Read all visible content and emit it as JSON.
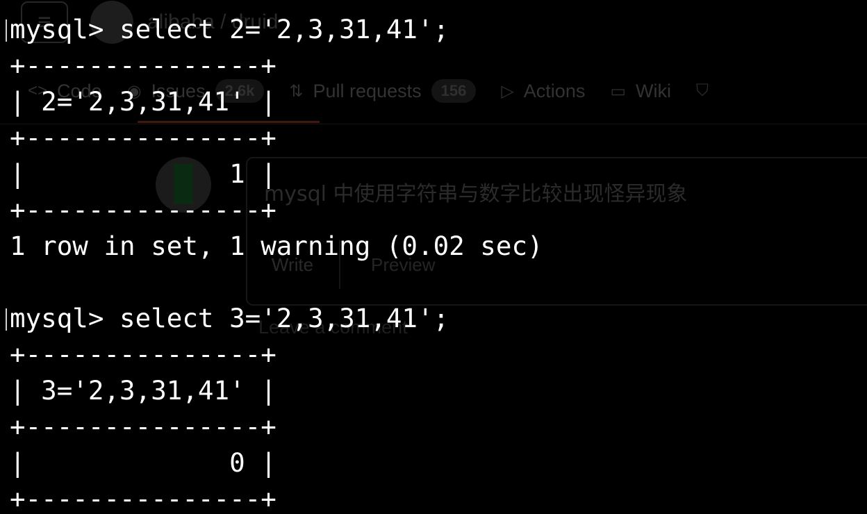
{
  "background_page": {
    "menu_icon": "hamburger-icon",
    "logo_icon": "github-mark-icon",
    "repo_path": "alibaba / druid",
    "tabs": [
      {
        "icon": "code-icon",
        "label": "Code",
        "counter": ""
      },
      {
        "icon": "issue-icon",
        "label": "Issues",
        "counter": "2.6k"
      },
      {
        "icon": "pull-request-icon",
        "label": "Pull requests",
        "counter": "156"
      },
      {
        "icon": "actions-icon",
        "label": "Actions",
        "counter": ""
      },
      {
        "icon": "wiki-icon",
        "label": "Wiki",
        "counter": ""
      },
      {
        "icon": "security-icon",
        "label": "",
        "counter": ""
      }
    ],
    "issue_title": "mysql 中使用字符串与数字比较出现怪异现象",
    "editor_tabs": {
      "write": "Write",
      "preview": "Preview"
    },
    "comment_placeholder": "Leave a comment"
  },
  "terminal": {
    "lines": [
      "mysql> select 2='2,3,31,41';",
      "+---------------+",
      "| 2='2,3,31,41' |",
      "+---------------+",
      "|             1 |",
      "+---------------+",
      "1 row in set, 1 warning (0.02 sec)",
      "",
      "mysql> select 3='2,3,31,41';",
      "+---------------+",
      "| 3='2,3,31,41' |",
      "+---------------+",
      "|             0 |",
      "+---------------+"
    ]
  },
  "colors": {
    "terminal_background": "#000000",
    "terminal_text": "#ffffff",
    "ghost_text": "#2e2e2e"
  }
}
